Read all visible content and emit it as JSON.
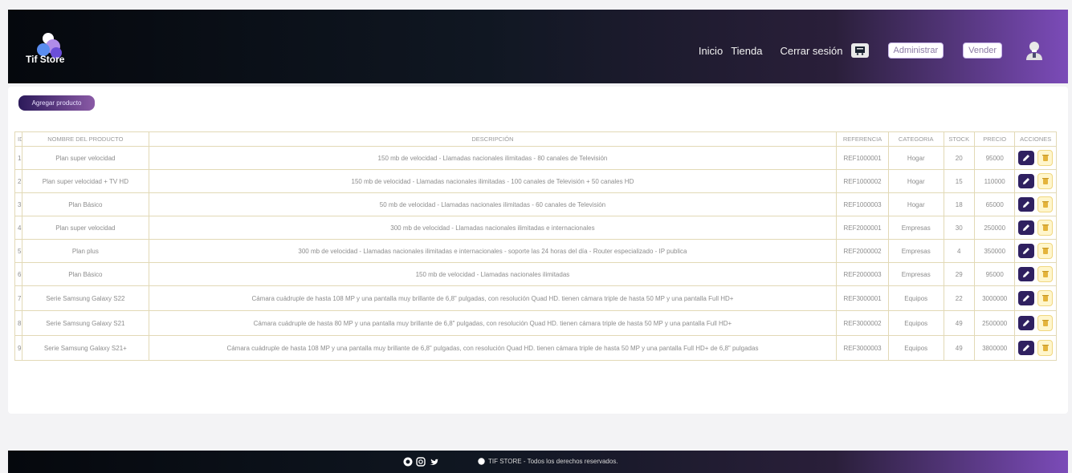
{
  "brand": {
    "name": "Tif Store",
    "logo_icon": "tif-logo-icon"
  },
  "nav": {
    "links": [
      "Inicio",
      "Tienda",
      "Cerrar sesión"
    ],
    "cart_icon": "cart-icon",
    "admin_label": "Administrar",
    "sell_label": "Vender",
    "user_icon": "user-icon"
  },
  "panel": {
    "add_label": "Agregar producto"
  },
  "table": {
    "headers": [
      "ID",
      "NOMBRE DEL PRODUCTO",
      "DESCRIPCIÓN",
      "REFERENCIA",
      "CATEGORIA",
      "STOCK",
      "PRECIO",
      "ACCIONES"
    ],
    "rows": [
      [
        "1",
        "Plan super velocidad",
        "150 mb de velocidad - Llamadas nacionales ilimitadas - 80 canales de Televisión",
        "REF1000001",
        "Hogar",
        "20",
        "95000"
      ],
      [
        "2",
        "Plan super velocidad + TV HD",
        "150 mb de velocidad - Llamadas nacionales ilimitadas - 100 canales de Televisión + 50 canales HD",
        "REF1000002",
        "Hogar",
        "15",
        "110000"
      ],
      [
        "3",
        "Plan Básico",
        "50 mb de velocidad - Llamadas nacionales ilimitadas - 60 canales de Televisión",
        "REF1000003",
        "Hogar",
        "18",
        "65000"
      ],
      [
        "4",
        "Plan super velocidad",
        "300 mb de velocidad - Llamadas nacionales ilimitadas e internacionales",
        "REF2000001",
        "Empresas",
        "30",
        "250000"
      ],
      [
        "5",
        "Plan plus",
        "300 mb de velocidad - Llamadas nacionales ilimitadas e internacionales - soporte las 24 horas del día - Router especializado - IP publica",
        "REF2000002",
        "Empresas",
        "4",
        "350000"
      ],
      [
        "6",
        "Plan Básico",
        "150 mb de velocidad - Llamadas nacionales ilimitadas",
        "REF2000003",
        "Empresas",
        "29",
        "95000"
      ],
      [
        "7",
        "Serie Samsung Galaxy S22",
        "Cámara cuádruple de hasta 108 MP y una pantalla muy brillante de 6,8\" pulgadas, con resolución Quad HD. tienen cámara triple de hasta 50 MP y una pantalla Full HD+",
        "REF3000001",
        "Equipos",
        "22",
        "3000000"
      ],
      [
        "8",
        "Serie Samsung Galaxy S21",
        "Cámara cuádruple de hasta 80 MP y una pantalla muy brillante de 6,8\" pulgadas, con resolución Quad HD. tienen cámara triple de hasta 50 MP y una pantalla Full HD+",
        "REF3000002",
        "Equipos",
        "49",
        "2500000"
      ],
      [
        "9",
        "Serie Samsung Galaxy S21+",
        "Cámara cuádruple de hasta 108 MP y una pantalla muy brillante de 6,8\" pulgadas, con resolución Quad HD. tienen cámara triple de hasta 50 MP y una pantalla Full HD+ de 6,8\" pulgadas",
        "REF3000003",
        "Equipos",
        "49",
        "3800000"
      ]
    ],
    "edit_icon": "edit-pencil-icon",
    "delete_icon": "trash-icon"
  },
  "footer": {
    "social_icons": [
      "github-icon",
      "instagram-icon",
      "twitter-icon"
    ],
    "copyright": "TIF STORE - Todos los derechos reservados."
  },
  "colors": {
    "accent": "#2f2060",
    "gradient_end": "#7b4bb8",
    "table_border": "#e2d9b6"
  }
}
